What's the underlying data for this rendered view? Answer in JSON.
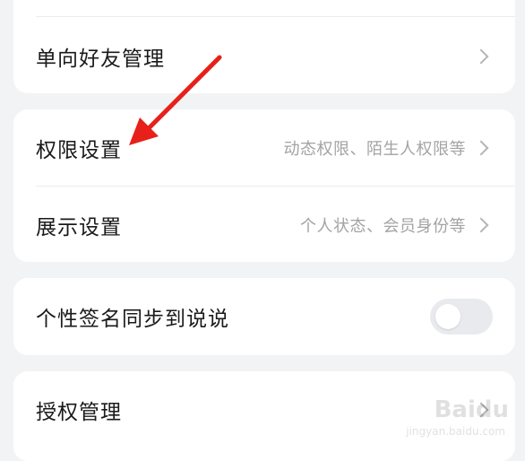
{
  "settings": {
    "one_way_friends": {
      "label": "单向好友管理"
    },
    "permissions": {
      "label": "权限设置",
      "hint": "动态权限、陌生人权限等"
    },
    "display": {
      "label": "展示设置",
      "hint": "个人状态、会员身份等"
    },
    "signature_sync": {
      "label": "个性签名同步到说说",
      "enabled": false
    },
    "authorization": {
      "label": "授权管理"
    }
  },
  "annotation": {
    "arrow_color": "#e8201a"
  },
  "watermark": {
    "text": "Baidu",
    "sub": "jingyan.baidu.com"
  },
  "colors": {
    "background": "#f2f3f5",
    "card": "#ffffff",
    "toggle_off": "#e9eaee"
  }
}
